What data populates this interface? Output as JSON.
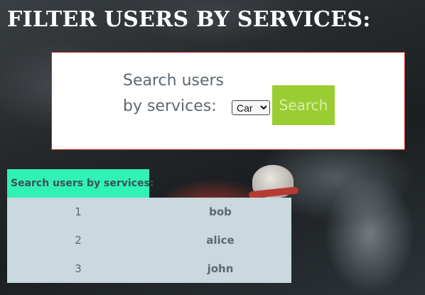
{
  "page": {
    "title": "FILTER USERS BY SERVICES:"
  },
  "search": {
    "label": "Search users by services:",
    "select_value": "Car",
    "button_label": "Search"
  },
  "results": {
    "caption": "Search users by services:",
    "rows": [
      {
        "id": "1",
        "name": "bob"
      },
      {
        "id": "2",
        "name": "alice"
      },
      {
        "id": "3",
        "name": "john"
      }
    ]
  },
  "colors": {
    "search_button": "#9acd32",
    "caption_bg": "#2ff2b4",
    "table_bg": "#c9d9dd",
    "card_border": "#c0281e"
  }
}
